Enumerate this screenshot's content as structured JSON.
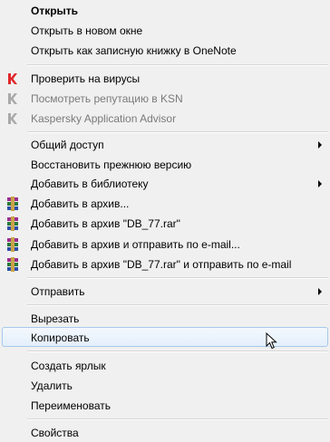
{
  "menu": {
    "items": [
      {
        "label": "Открыть"
      },
      {
        "label": "Открыть в новом окне"
      },
      {
        "label": "Открыть как записную книжку в OneNote"
      },
      {
        "label": "Проверить на вирусы"
      },
      {
        "label": "Посмотреть репутацию в KSN"
      },
      {
        "label": "Kaspersky Application Advisor"
      },
      {
        "label": "Общий доступ"
      },
      {
        "label": "Восстановить прежнюю версию"
      },
      {
        "label": "Добавить в библиотеку"
      },
      {
        "label": "Добавить в архив..."
      },
      {
        "label": "Добавить в архив \"DB_77.rar\""
      },
      {
        "label": "Добавить в архив и отправить по e-mail..."
      },
      {
        "label": "Добавить в архив \"DB_77.rar\" и отправить по e-mail"
      },
      {
        "label": "Отправить"
      },
      {
        "label": "Вырезать"
      },
      {
        "label": "Копировать"
      },
      {
        "label": "Создать ярлык"
      },
      {
        "label": "Удалить"
      },
      {
        "label": "Переименовать"
      },
      {
        "label": "Свойства"
      }
    ]
  },
  "icons": {
    "kaspersky": "kaspersky-icon",
    "winrar": "winrar-archive-icon"
  },
  "colors": {
    "menu_bg": "#f0f0f0",
    "hover_border": "#a8c8ea",
    "disabled_text": "#7a7a7a",
    "kaspersky_red": "#e0262b"
  }
}
